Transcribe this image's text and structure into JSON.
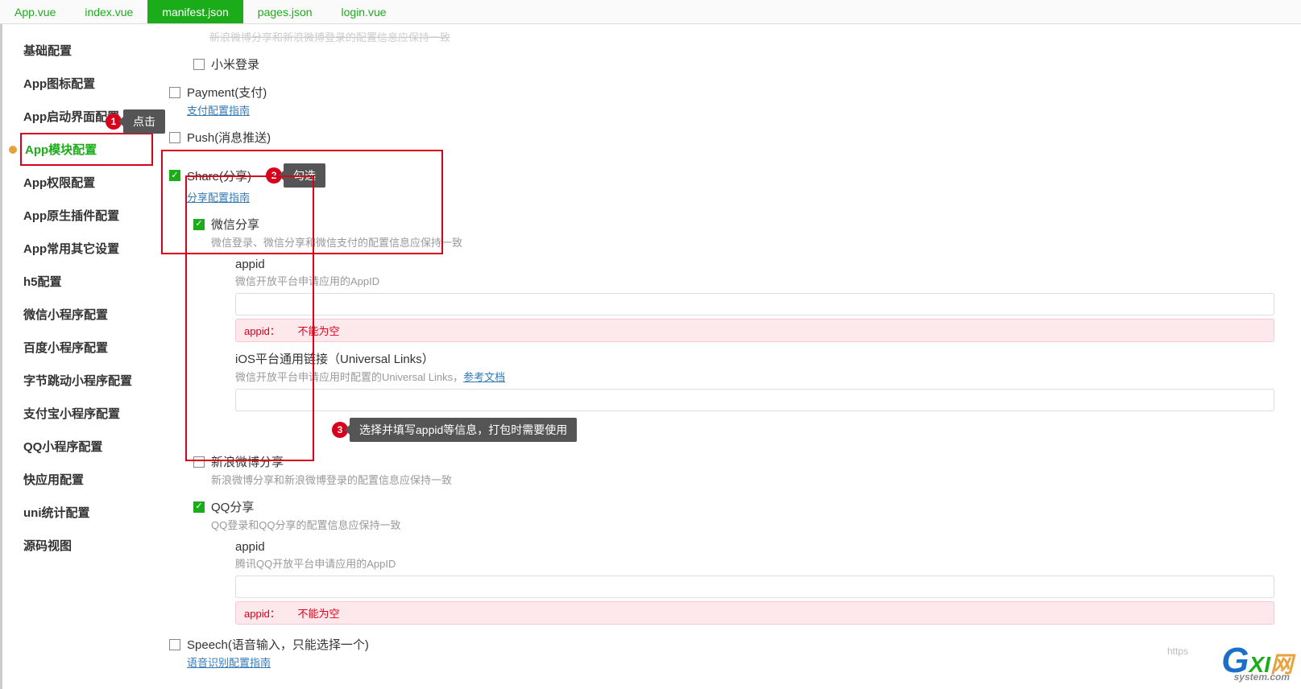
{
  "tabs": [
    {
      "label": "App.vue"
    },
    {
      "label": "index.vue"
    },
    {
      "label": "manifest.json",
      "active": true
    },
    {
      "label": "pages.json"
    },
    {
      "label": "login.vue"
    }
  ],
  "sidebar": [
    {
      "label": "基础配置"
    },
    {
      "label": "App图标配置"
    },
    {
      "label": "App启动界面配置"
    },
    {
      "label": "App模块配置",
      "active": true,
      "warn": true
    },
    {
      "label": "App权限配置"
    },
    {
      "label": "App原生插件配置"
    },
    {
      "label": "App常用其它设置"
    },
    {
      "label": "h5配置"
    },
    {
      "label": "微信小程序配置"
    },
    {
      "label": "百度小程序配置"
    },
    {
      "label": "字节跳动小程序配置"
    },
    {
      "label": "支付宝小程序配置"
    },
    {
      "label": "QQ小程序配置"
    },
    {
      "label": "快应用配置"
    },
    {
      "label": "uni统计配置"
    },
    {
      "label": "源码视图"
    }
  ],
  "annotations": {
    "a1": {
      "num": "1",
      "text": "点击"
    },
    "a2": {
      "num": "2",
      "text": "勾选"
    },
    "a3": {
      "num": "3",
      "text": "选择并填写appid等信息，打包时需要使用"
    }
  },
  "top_truncated": "新浪微博分享和新浪微博登录的配置信息应保持一致",
  "xiaomi": {
    "label": "小米登录"
  },
  "payment": {
    "label": "Payment(支付)",
    "guide": "支付配置指南"
  },
  "push": {
    "label": "Push(消息推送)"
  },
  "share": {
    "label": "Share(分享)",
    "guide": "分享配置指南"
  },
  "wechat_share": {
    "label": "微信分享",
    "desc": "微信登录、微信分享和微信支付的配置信息应保持一致",
    "appid_label": "appid",
    "appid_desc": "微信开放平台申请应用的AppID",
    "err_key": "appid：",
    "err_msg": "不能为空",
    "ul_label": "iOS平台通用链接（Universal Links）",
    "ul_desc_pre": "微信开放平台申请应用时配置的Universal Links，",
    "ul_ref": "参考文档"
  },
  "weibo_share": {
    "label": "新浪微博分享",
    "desc": "新浪微博分享和新浪微博登录的配置信息应保持一致"
  },
  "qq_share": {
    "label": "QQ分享",
    "desc": "QQ登录和QQ分享的配置信息应保持一致",
    "appid_label": "appid",
    "appid_desc": "腾讯QQ开放平台申请应用的AppID",
    "err_key": "appid：",
    "err_msg": "不能为空"
  },
  "speech": {
    "label": "Speech(语音输入，只能选择一个)",
    "guide": "语音识别配置指南"
  },
  "watermark": {
    "g": "G",
    "xi": "XI",
    "net": "网",
    "sub": "system.com"
  },
  "footer_https": "https"
}
